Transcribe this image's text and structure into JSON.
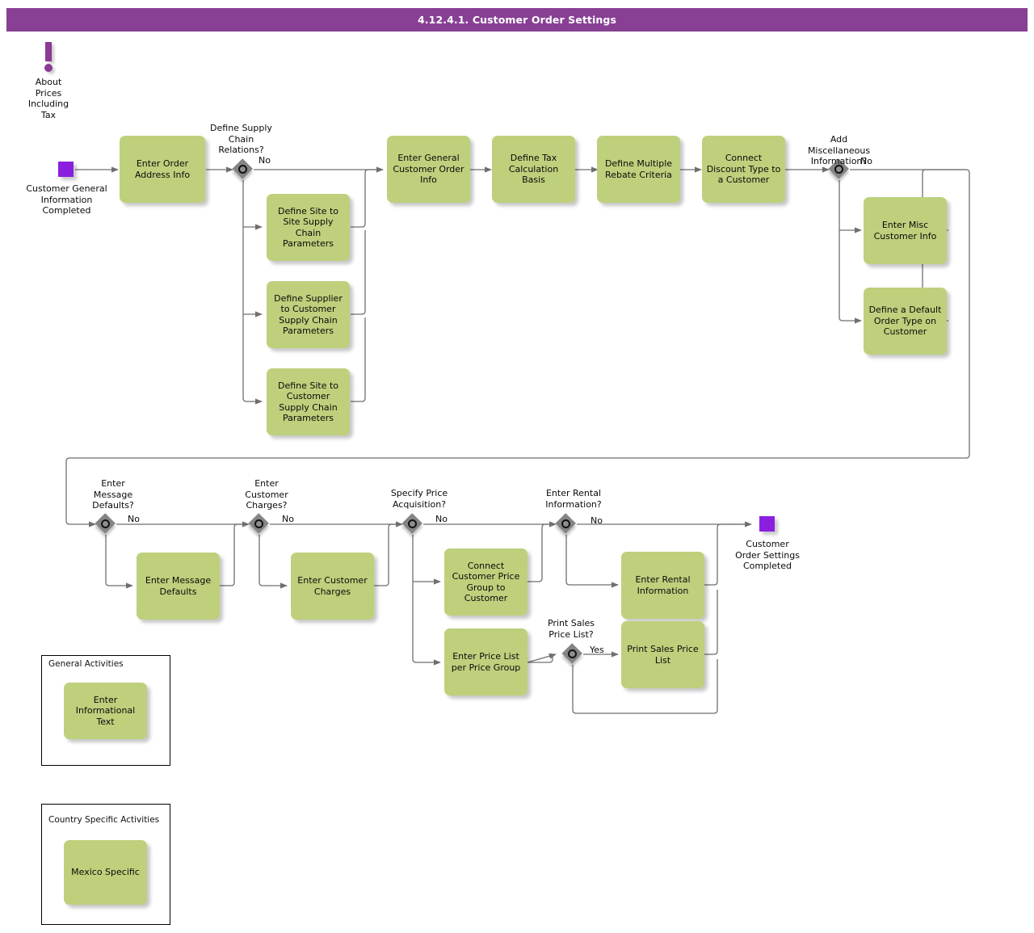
{
  "header": {
    "title": "4.12.4.1. Customer Order Settings"
  },
  "annotation": {
    "icon": "info-exclamation-marker",
    "text": "About\nPrices\nIncluding\nTax"
  },
  "events": {
    "start": {
      "name": "start-event",
      "label": "Customer General\nInformation\nCompleted"
    },
    "end": {
      "name": "end-event",
      "label": "Customer\nOrder Settings\nCompleted"
    }
  },
  "gateways": [
    {
      "id": "gw-supply-chain",
      "label": "Define Supply\nChain\nRelations?",
      "branch": "No"
    },
    {
      "id": "gw-misc-info",
      "label": "Add\nMiscellaneous\nInformation?",
      "branch": "No"
    },
    {
      "id": "gw-message-def",
      "label": "Enter\nMessage\nDefaults?",
      "branch": "No"
    },
    {
      "id": "gw-cust-charges",
      "label": "Enter\nCustomer\nCharges?",
      "branch": "No"
    },
    {
      "id": "gw-price-acq",
      "label": "Specify Price\nAcquisition?",
      "branch": "No"
    },
    {
      "id": "gw-rental-info",
      "label": "Enter Rental\nInformation?",
      "branch": "No"
    },
    {
      "id": "gw-print-price",
      "label": "Print Sales\nPrice List?",
      "branch": "Yes"
    }
  ],
  "tasks": [
    {
      "id": "t-enter-order-address",
      "label": "Enter Order\nAddress Info"
    },
    {
      "id": "t-site-to-site",
      "label": "Define Site to\nSite Supply\nChain\nParameters"
    },
    {
      "id": "t-supplier-to-customer",
      "label": "Define Supplier\nto Customer\nSupply Chain\nParameters"
    },
    {
      "id": "t-site-to-customer",
      "label": "Define Site to\nCustomer\nSupply Chain\nParameters"
    },
    {
      "id": "t-general-order-info",
      "label": "Enter General\nCustomer Order\nInfo"
    },
    {
      "id": "t-tax-calc-basis",
      "label": "Define Tax\nCalculation\nBasis"
    },
    {
      "id": "t-multiple-rebate",
      "label": "Define Multiple\nRebate\nCriteria"
    },
    {
      "id": "t-connect-discount",
      "label": "Connect\nDiscount Type to\na Customer"
    },
    {
      "id": "t-misc-customer-info",
      "label": "Enter Misc\nCustomer Info"
    },
    {
      "id": "t-default-order-type",
      "label": "Define a Default\nOrder Type on\nCustomer"
    },
    {
      "id": "t-message-defaults",
      "label": "Enter Message\nDefaults"
    },
    {
      "id": "t-customer-charges",
      "label": "Enter Customer\nCharges"
    },
    {
      "id": "t-price-group",
      "label": "Connect\nCustomer Price\nGroup to\nCustomer"
    },
    {
      "id": "t-price-list-per-group",
      "label": "Enter Price List\nper Price Group"
    },
    {
      "id": "t-rental-information",
      "label": "Enter Rental\nInformation"
    },
    {
      "id": "t-print-sales-price",
      "label": "Print Sales Price\nList"
    }
  ],
  "legends": [
    {
      "id": "legend-general",
      "title": "General Activities",
      "task": "Enter\nInformational\nText"
    },
    {
      "id": "legend-country",
      "title": "Country Specific Activities",
      "task": "Mexico Specific"
    }
  ],
  "colors": {
    "header_purple": "#874093",
    "task_green": "#bed07c",
    "event_purple": "#8b1fe0",
    "gateway_gray": "#848484",
    "connector_gray": "#6f6f6f",
    "annotation_purple": "#8b3a96"
  }
}
